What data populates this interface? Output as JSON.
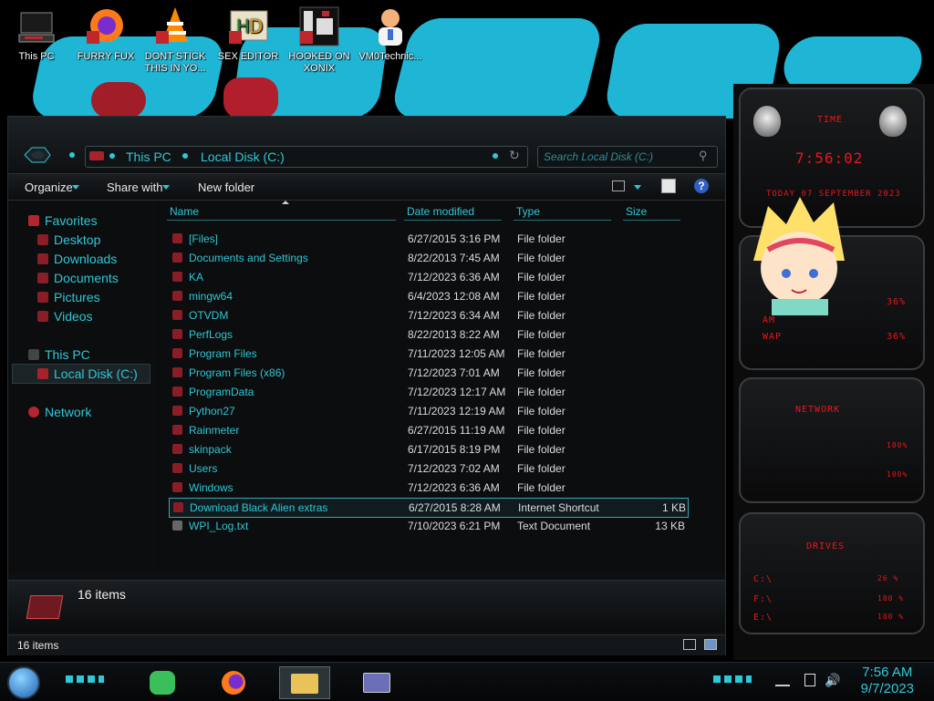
{
  "desktop": {
    "icons": [
      {
        "label": "This PC",
        "icon": "computer-icon"
      },
      {
        "label": "FURRY FUX",
        "icon": "firefox-icon"
      },
      {
        "label": "DONT STICK THIS IN YO...",
        "icon": "vlc-cone-icon"
      },
      {
        "label": "SEX EDITOR",
        "icon": "hex-editor-icon"
      },
      {
        "label": "HOOKED ON XONIX",
        "icon": "game-icon"
      },
      {
        "label": "VM0Technic...",
        "icon": "doctor-icon"
      }
    ]
  },
  "explorer": {
    "breadcrumb": [
      "This PC",
      "Local Disk (C:)"
    ],
    "search_placeholder": "Search Local Disk (C:)",
    "toolbar": {
      "organize": "Organize",
      "share_with": "Share with",
      "new_folder": "New folder"
    },
    "nav": {
      "favorites": "Favorites",
      "favorites_items": [
        "Desktop",
        "Downloads",
        "Documents",
        "Pictures",
        "Videos"
      ],
      "this_pc": "This PC",
      "local_disk": "Local Disk (C:)",
      "network": "Network"
    },
    "columns": {
      "name": "Name",
      "date": "Date modified",
      "type": "Type",
      "size": "Size"
    },
    "files": [
      {
        "name": "[Files]",
        "date": "6/27/2015 3:16 PM",
        "type": "File folder",
        "size": ""
      },
      {
        "name": "Documents and Settings",
        "date": "8/22/2013 7:45 AM",
        "type": "File folder",
        "size": ""
      },
      {
        "name": "KA",
        "date": "7/12/2023 6:36 AM",
        "type": "File folder",
        "size": ""
      },
      {
        "name": "mingw64",
        "date": "6/4/2023 12:08 AM",
        "type": "File folder",
        "size": ""
      },
      {
        "name": "OTVDM",
        "date": "7/12/2023 6:34 AM",
        "type": "File folder",
        "size": ""
      },
      {
        "name": "PerfLogs",
        "date": "8/22/2013 8:22 AM",
        "type": "File folder",
        "size": ""
      },
      {
        "name": "Program Files",
        "date": "7/11/2023 12:05 AM",
        "type": "File folder",
        "size": ""
      },
      {
        "name": "Program Files (x86)",
        "date": "7/12/2023 7:01 AM",
        "type": "File folder",
        "size": ""
      },
      {
        "name": "ProgramData",
        "date": "7/12/2023 12:17 AM",
        "type": "File folder",
        "size": ""
      },
      {
        "name": "Python27",
        "date": "7/11/2023 12:19 AM",
        "type": "File folder",
        "size": ""
      },
      {
        "name": "Rainmeter",
        "date": "6/27/2015 11:19 AM",
        "type": "File folder",
        "size": ""
      },
      {
        "name": "skinpack",
        "date": "6/17/2015 8:19 PM",
        "type": "File folder",
        "size": ""
      },
      {
        "name": "Users",
        "date": "7/12/2023 7:02 AM",
        "type": "File folder",
        "size": ""
      },
      {
        "name": "Windows",
        "date": "7/12/2023 6:36 AM",
        "type": "File folder",
        "size": ""
      },
      {
        "name": "Download Black Alien extras",
        "date": "6/27/2015 8:28 AM",
        "type": "Internet Shortcut",
        "size": "1 KB"
      },
      {
        "name": "WPI_Log.txt",
        "date": "7/10/2023 6:21 PM",
        "type": "Text Document",
        "size": "13 KB"
      }
    ],
    "details_count": "16 items",
    "status_count": "16 items"
  },
  "gadget": {
    "time_label": "TIME",
    "time_value": "7:56:02",
    "date_line": "TODAY 07 SEPTEMBER 2023",
    "ram_label": "AM",
    "ram_pct": "36%",
    "swap_label": "WAP",
    "swap_pct": "36%",
    "network_label": "NETWORK",
    "net_in": "100%",
    "net_out": "100%",
    "drives_label": "DRIVES",
    "drives": [
      {
        "label": "C:\\",
        "pct": "26 %"
      },
      {
        "label": "F:\\",
        "pct": "100 %"
      },
      {
        "label": "E:\\",
        "pct": "100 %"
      }
    ]
  },
  "taskbar": {
    "time": "7:56 AM",
    "date": "9/7/2023"
  },
  "colors": {
    "accent": "#2ec8d6",
    "gadget_red": "#e8171b",
    "wallpaper_blue": "#1fb6d6"
  }
}
